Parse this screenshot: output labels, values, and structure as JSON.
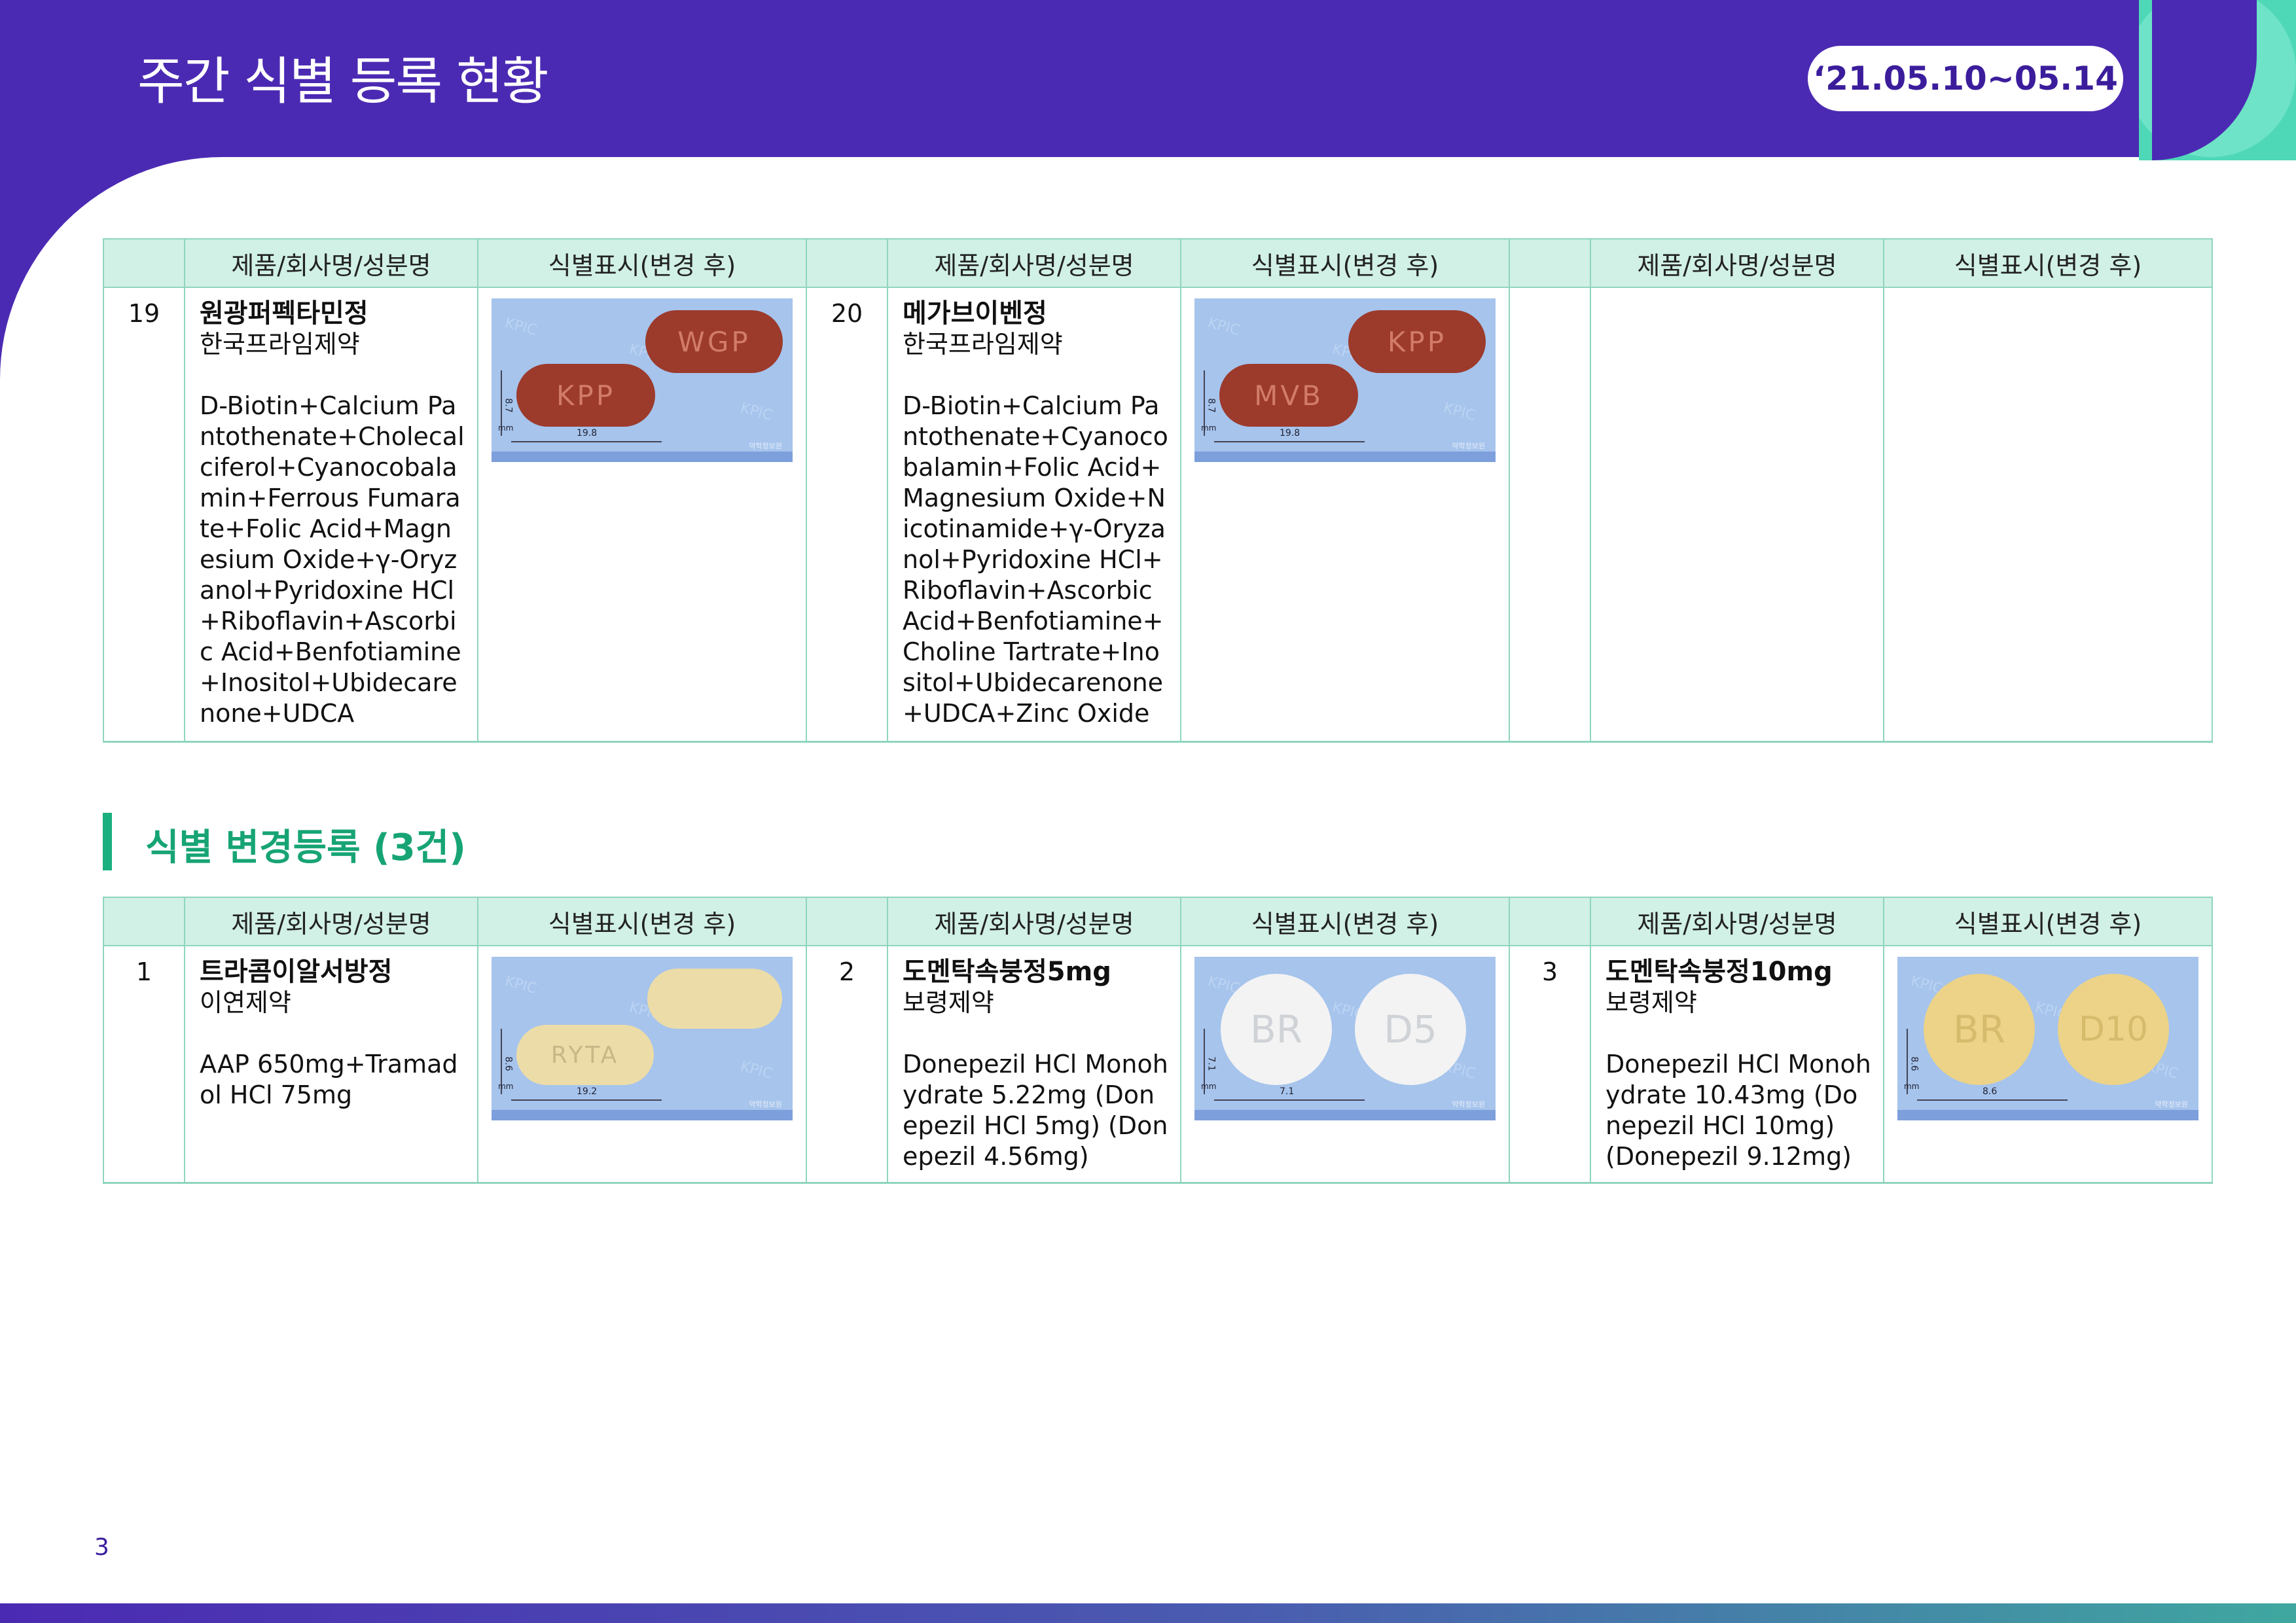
{
  "header": {
    "title": "주간 식별 등록 현황",
    "date_range": "‘21.05.10~05.14"
  },
  "columns": {
    "product": "제품/회사명/성분명",
    "marking": "식별표시(변경 후)"
  },
  "table1": {
    "items": [
      {
        "no": "19",
        "name": "원광퍼펙타민정",
        "company": "한국프라임제약",
        "ingredients": "D-Biotin+Calcium Pantothenate+Cholecalciferol+Cyanocobalamin+Ferrous Fumarate+Folic Acid+Magnesium Oxide+γ-Oryzanol+Pyridoxine HCl+Riboflavin+Ascorbic Acid+Benfotiamine+Inositol+Ubidecarenone+UDCA",
        "pill": {
          "front": "KPP",
          "back": "WGP",
          "scale_x": "19.8",
          "scale_y": "8.7",
          "color": "#9c3a2c"
        }
      },
      {
        "no": "20",
        "name": "메가브이벤정",
        "company": "한국프라임제약",
        "ingredients": "D-Biotin+Calcium Pantothenate+Cyanocobalamin+Folic Acid+Magnesium Oxide+Nicotinamide+γ-Oryzanol+Pyridoxine HCl+Riboflavin+Ascorbic Acid+Benfotiamine+Choline Tartrate+Inositol+Ubidecarenone+UDCA+Zinc Oxide",
        "pill": {
          "front": "MVB",
          "back": "KPP",
          "scale_x": "19.8",
          "scale_y": "8.7",
          "color": "#9c3a2c"
        }
      }
    ]
  },
  "section": {
    "title": "식별 변경등록 (3건)"
  },
  "table2": {
    "items": [
      {
        "no": "1",
        "name": "트라콤이알서방정",
        "company": "이연제약",
        "ingredients": "AAP 650mg+Tramadol HCl 75mg",
        "pill": {
          "front": "RYTA",
          "back": "",
          "scale_x": "19.2",
          "scale_y": "8.6",
          "color": "#ecdca8"
        }
      },
      {
        "no": "2",
        "name": "도멘탁속붕정5mg",
        "company": "보령제약",
        "ingredients": "Donepezil HCl Monohydrate 5.22mg (Donepezil HCl 5mg) (Donepezil 4.56mg)",
        "pill": {
          "front": "BR",
          "back": "D5",
          "scale_x": "7.1",
          "scale_y": "7.1",
          "color": "#f3f3f3"
        }
      },
      {
        "no": "3",
        "name": "도멘탁속붕정10mg",
        "company": "보령제약",
        "ingredients": "Donepezil HCl Monohydrate 10.43mg (Donepezil HCl 10mg) (Donepezil 9.12mg)",
        "pill": {
          "front": "BR",
          "back": "D10",
          "scale_x": "8.6",
          "scale_y": "8.6",
          "color": "#ecd388"
        }
      }
    ]
  },
  "photo": {
    "watermark": "KPIC",
    "unit": "mm",
    "brand": "약학정보원"
  },
  "page_number": "3"
}
